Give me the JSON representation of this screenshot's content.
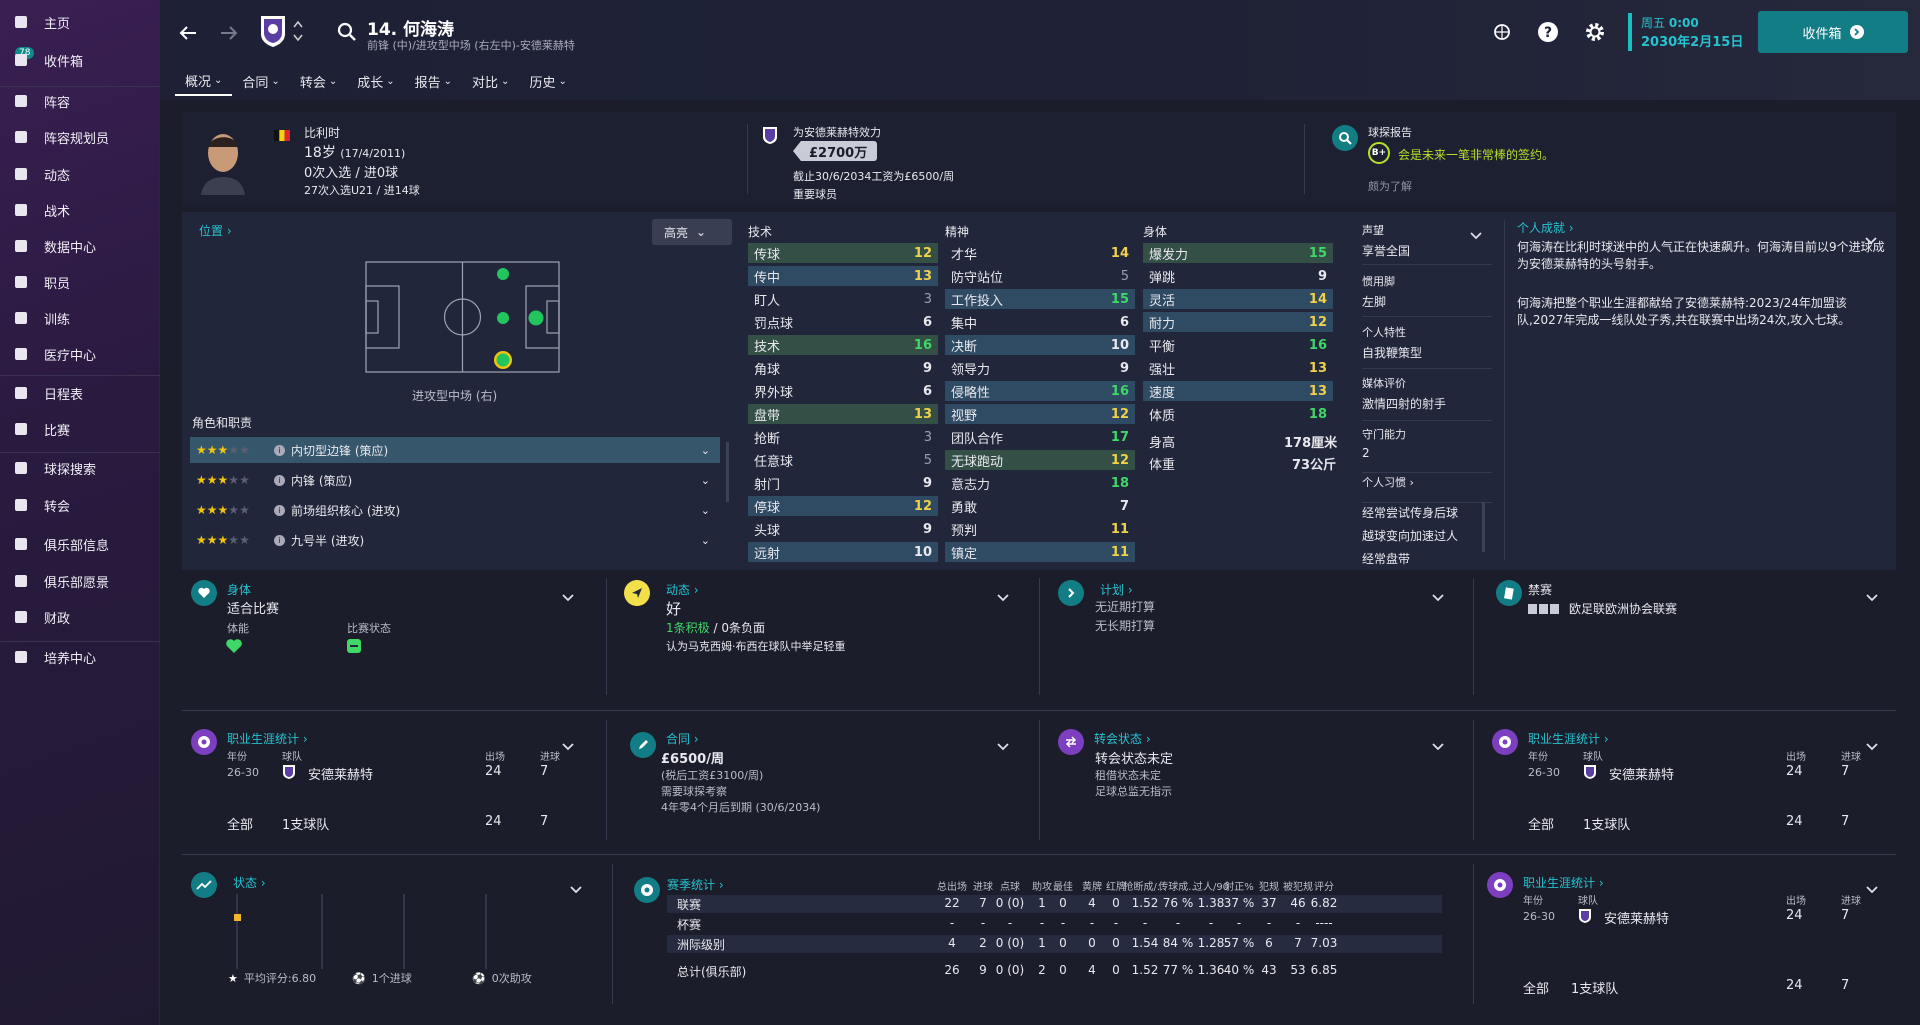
{
  "sidebar": {
    "inbox_badge": "78",
    "items": [
      {
        "label": "主页",
        "icon": "home-icon"
      },
      {
        "label": "收件箱",
        "icon": "inbox-icon"
      },
      {
        "label": "阵容",
        "icon": "squad-icon"
      },
      {
        "label": "阵容规划员",
        "icon": "clipboard-icon"
      },
      {
        "label": "动态",
        "icon": "dynamics-icon"
      },
      {
        "label": "战术",
        "icon": "tactics-icon"
      },
      {
        "label": "数据中心",
        "icon": "data-hub-icon"
      },
      {
        "label": "职员",
        "icon": "staff-icon"
      },
      {
        "label": "训练",
        "icon": "training-icon"
      },
      {
        "label": "医疗中心",
        "icon": "medical-icon"
      },
      {
        "label": "日程表",
        "icon": "calendar-icon"
      },
      {
        "label": "比赛",
        "icon": "trophy-icon"
      },
      {
        "label": "球探搜索",
        "icon": "scout-search-icon"
      },
      {
        "label": "转会",
        "icon": "transfer-icon"
      },
      {
        "label": "俱乐部信息",
        "icon": "shield-icon"
      },
      {
        "label": "俱乐部愿景",
        "icon": "briefcase-icon"
      },
      {
        "label": "财政",
        "icon": "finance-icon"
      },
      {
        "label": "培养中心",
        "icon": "development-icon"
      }
    ]
  },
  "header": {
    "player_title": "14. 何海涛",
    "player_subtitle": "前锋 (中)/进攻型中场 (右左中)-安德莱赫特",
    "day": "周五",
    "time": "0:00",
    "date": "2030年2月15日",
    "continue_label": "收件箱",
    "tabs": [
      "概况",
      "合同",
      "转会",
      "成长",
      "报告",
      "对比",
      "历史"
    ]
  },
  "profile": {
    "nationality": "比利时",
    "age": "18岁",
    "dob": "(17/4/2011)",
    "caps": "0次入选 / 进0球",
    "u21": "27次入选U21 / 进14球",
    "plays_for": "为安德莱赫特效力",
    "value": "£2700万",
    "contract": "截止30/6/2034工资为£6500/周",
    "squad_status": "重要球员",
    "scout_title": "球探报告",
    "scout_grade": "B+",
    "scout_text": "会是未来一笔非常棒的签约。",
    "scout_more": "颇为了解"
  },
  "position": {
    "title": "位置",
    "highlight": "高亮",
    "pitch_label": "进攻型中场 (右)",
    "roles_title": "角色和职责",
    "roles": [
      {
        "name": "内切型边锋 (策应)",
        "stars": 2.5
      },
      {
        "name": "内锋 (策应)",
        "stars": 2.5
      },
      {
        "name": "前场组织核心 (进攻)",
        "stars": 2.5
      },
      {
        "name": "九号半 (进攻)",
        "stars": 2.5
      }
    ]
  },
  "attributes": {
    "technical_title": "技术",
    "mental_title": "精神",
    "physical_title": "身体",
    "technical": [
      [
        "传球",
        "12"
      ],
      [
        "传中",
        "13"
      ],
      [
        "盯人",
        "3"
      ],
      [
        "罚点球",
        "6"
      ],
      [
        "技术",
        "16"
      ],
      [
        "角球",
        "9"
      ],
      [
        "界外球",
        "6"
      ],
      [
        "盘带",
        "13"
      ],
      [
        "抢断",
        "3"
      ],
      [
        "任意球",
        "5"
      ],
      [
        "射门",
        "9"
      ],
      [
        "停球",
        "12"
      ],
      [
        "头球",
        "9"
      ],
      [
        "远射",
        "10"
      ]
    ],
    "mental": [
      [
        "才华",
        "14"
      ],
      [
        "防守站位",
        "5"
      ],
      [
        "工作投入",
        "15"
      ],
      [
        "集中",
        "6"
      ],
      [
        "决断",
        "10"
      ],
      [
        "领导力",
        "9"
      ],
      [
        "侵略性",
        "16"
      ],
      [
        "视野",
        "12"
      ],
      [
        "团队合作",
        "17"
      ],
      [
        "无球跑动",
        "12"
      ],
      [
        "意志力",
        "18"
      ],
      [
        "勇敢",
        "7"
      ],
      [
        "预判",
        "11"
      ],
      [
        "镇定",
        "11"
      ]
    ],
    "physical": [
      [
        "爆发力",
        "15"
      ],
      [
        "弹跳",
        "9"
      ],
      [
        "灵活",
        "14"
      ],
      [
        "耐力",
        "12"
      ],
      [
        "平衡",
        "16"
      ],
      [
        "强壮",
        "13"
      ],
      [
        "速度",
        "13"
      ],
      [
        "体质",
        "18"
      ]
    ],
    "height_label": "身高",
    "height_value": "178厘米",
    "weight_label": "体重",
    "weight_value": "73公斤"
  },
  "traits": {
    "reputation_label": "声望",
    "reputation_value": "享誉全国",
    "foot_label": "惯用脚",
    "foot_value": "左脚",
    "personality_label": "个人特性",
    "personality_value": "自我鞭策型",
    "media_label": "媒体评价",
    "media_value": "激情四射的射手",
    "gk_label": "守门能力",
    "gk_value": "2",
    "habits_label": "个人习惯",
    "habits": [
      "经常尝试传身后球",
      "越球变向加速过人",
      "经常盘带"
    ]
  },
  "achievements": {
    "title": "个人成就",
    "para1": "何海涛在比利时球迷中的人气正在快速飙升。何海涛目前以9个进球成为安德莱赫特的头号射手。",
    "para2": "何海涛把整个职业生涯都献给了安德莱赫特:2023/24年加盟该队,2027年完成一线队处子秀,共在联赛中出场24次,攻入七球。"
  },
  "cards_row1": {
    "fitness_title": "身体",
    "fitness_value": "适合比赛",
    "fitness_label": "体能",
    "match_label": "比赛状态",
    "dyn_title": "动态",
    "dyn_value": "好",
    "dyn_pos": "1条积极",
    "dyn_neg": "/ 0条负面",
    "dyn_note": "认为马克西姆·布西在球队中举足轻重",
    "plan_title": "计划",
    "plan_1": "无近期打算",
    "plan_2": "无长期打算",
    "ban_title": "禁赛",
    "ban_text": "欧足联欧洲协会联赛"
  },
  "cards_row2": {
    "career_title": "职业生涯统计",
    "col_year": "年份",
    "col_team": "球队",
    "col_apps": "出场",
    "col_goals": "进球",
    "row_year": "26-30",
    "row_team": "安德莱赫特",
    "row_apps": "24",
    "row_goals": "7",
    "total_label": "全部",
    "total_team": "1支球队",
    "total_apps": "24",
    "total_goals": "7",
    "contract_title": "合同",
    "contract_wage": "£6500/周",
    "contract_after_tax": "(税后工资£3100/周)",
    "contract_note": "需要球探考察",
    "contract_expiry": "4年零4个月后到期 (30/6/2034)",
    "transfer_title": "转会状态",
    "transfer_value": "转会状态未定",
    "transfer_loan": "租借状态未定",
    "transfer_note": "足球总监无指示"
  },
  "cards_row3": {
    "form_title": "状态",
    "form_avg": "平均评分:6.80",
    "form_goals": "1个进球",
    "form_assists": "0次助攻",
    "season_title": "赛季统计",
    "season_headers": [
      "总出场",
      "进球",
      "点球",
      "助攻",
      "最佳",
      "黄牌",
      "红牌",
      "抢断成/...",
      "传球成...",
      "过人/90",
      "射正%",
      "犯规",
      "被犯规",
      "评分"
    ],
    "season_rows": [
      {
        "label": "联赛",
        "vals": [
          "22",
          "7",
          "0 (0)",
          "1",
          "0",
          "4",
          "0",
          "1.52",
          "76 %",
          "1.38",
          "37 %",
          "37",
          "46",
          "6.82"
        ]
      },
      {
        "label": "杯赛",
        "vals": [
          "-",
          "-",
          "-",
          "-",
          "-",
          "-",
          "-",
          "-",
          "-",
          "-",
          "-",
          "-",
          "-",
          "----"
        ]
      },
      {
        "label": "洲际级别",
        "vals": [
          "4",
          "2",
          "0 (0)",
          "1",
          "0",
          "0",
          "0",
          "1.54",
          "84 %",
          "1.28",
          "57 %",
          "6",
          "7",
          "7.03"
        ]
      },
      {
        "label": "总计(俱乐部)",
        "vals": [
          "26",
          "9",
          "0 (0)",
          "2",
          "0",
          "4",
          "0",
          "1.52",
          "77 %",
          "1.36",
          "40 %",
          "43",
          "53",
          "6.85"
        ]
      }
    ]
  },
  "colors": {
    "accent": "#18c0c0",
    "sidebar": "#2a1a40",
    "good": "#3fd868",
    "warn": "#f1d04a"
  }
}
